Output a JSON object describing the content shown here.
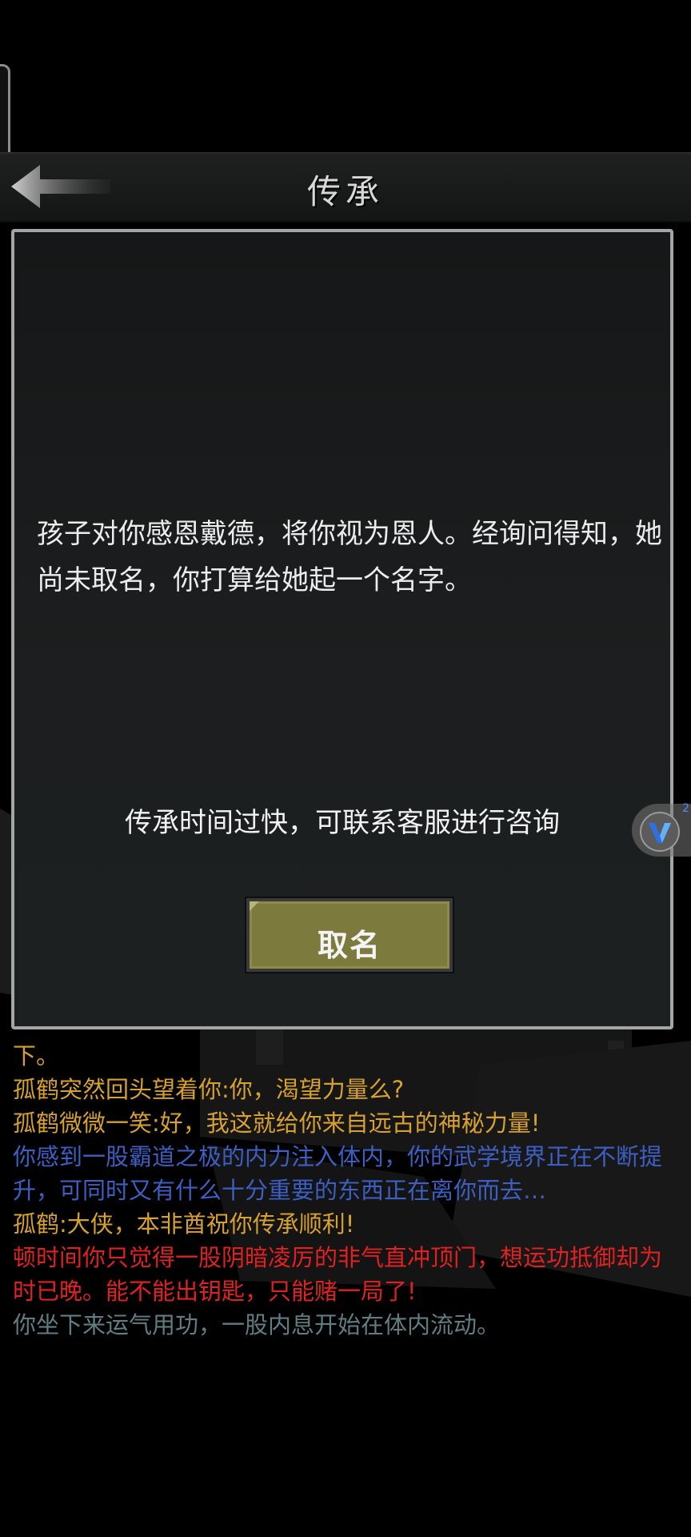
{
  "header": {
    "title": "传承",
    "back_icon": "arrow-left-icon"
  },
  "dialog": {
    "story_text": "孩子对你感恩戴德，将你视为恩人。经询问得知，她尚未取名，你打算给她起一个名字。",
    "notice_text": "传承时间过快，可联系客服进行咨询",
    "button_label": "取名"
  },
  "float_widget": {
    "icon": "v-logo-icon",
    "badge": "2"
  },
  "log": [
    {
      "text": "下。",
      "color": "#d7a12e"
    },
    {
      "text": "孤鹤突然回头望着你:你，渴望力量么?",
      "color": "#d7a12e"
    },
    {
      "text": "孤鹤微微一笑:好，我这就给你来自远古的神秘力量!",
      "color": "#d7a12e"
    },
    {
      "text": "你感到一股霸道之极的内力注入体内，你的武学境界正在不断提升，可同时又有什么十分重要的东西正在离你而去…",
      "color": "#3d5fc4"
    },
    {
      "text": "孤鹤:大侠，本非酋祝你传承顺利!",
      "color": "#d7a12e"
    },
    {
      "text": "顿时间你只觉得一股阴暗凌厉的非气直冲顶门，想运功抵御却为时已晚。能不能出钥匙，只能赌一局了!",
      "color": "#e02121"
    },
    {
      "text": "你坐下来运气用功，一股内息开始在体内流动。",
      "color": "#5f7e83"
    }
  ]
}
